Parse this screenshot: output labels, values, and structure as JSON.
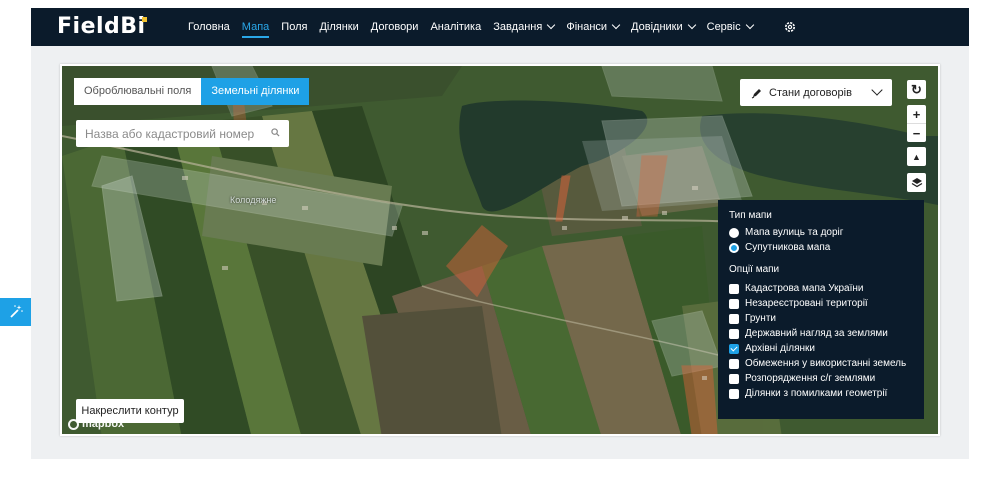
{
  "brand": {
    "logo_text": "FieldBi",
    "logo_main": "Field",
    "logo_accent": "Bi"
  },
  "nav": {
    "items": [
      {
        "label": "Головна",
        "active": false,
        "dropdown": false
      },
      {
        "label": "Мапа",
        "active": true,
        "dropdown": false
      },
      {
        "label": "Поля",
        "active": false,
        "dropdown": false
      },
      {
        "label": "Ділянки",
        "active": false,
        "dropdown": false
      },
      {
        "label": "Договори",
        "active": false,
        "dropdown": false
      },
      {
        "label": "Аналітика",
        "active": false,
        "dropdown": false
      },
      {
        "label": "Завдання",
        "active": false,
        "dropdown": true
      },
      {
        "label": "Фінанси",
        "active": false,
        "dropdown": true
      },
      {
        "label": "Довідники",
        "active": false,
        "dropdown": true
      },
      {
        "label": "Сервіс",
        "active": false,
        "dropdown": true
      }
    ],
    "settings_icon": "gear-icon"
  },
  "map": {
    "tabs": [
      {
        "label": "Оброблювальні поля",
        "active": false
      },
      {
        "label": "Земельні ділянки",
        "active": true
      }
    ],
    "search": {
      "placeholder": "Назва або кадастровий номер",
      "value": ""
    },
    "contracts_dropdown": {
      "label": "Стани договорів",
      "icon": "pen-icon"
    },
    "controls": {
      "refresh": "↻",
      "zoom_in": "+",
      "zoom_out": "−",
      "compass": "▲",
      "layers_icon": "layers-icon"
    },
    "village_label": "Колодяжне",
    "draw_button": "Накреслити контур",
    "attribution": "mapbox"
  },
  "layers_panel": {
    "map_type_title": "Тип мапи",
    "map_types": [
      {
        "label": "Мапа вулиць та доріг",
        "selected": false
      },
      {
        "label": "Супутникова мапа",
        "selected": true
      }
    ],
    "options_title": "Опції мапи",
    "options": [
      {
        "label": "Кадастрова мапа України",
        "checked": false
      },
      {
        "label": "Незареєстровані території",
        "checked": false
      },
      {
        "label": "Грунти",
        "checked": false
      },
      {
        "label": "Державний нагляд за землями",
        "checked": false
      },
      {
        "label": "Архівні ділянки",
        "checked": true
      },
      {
        "label": "Обмеження у використанні земель",
        "checked": false
      },
      {
        "label": "Розпорядження с/г землями",
        "checked": false
      },
      {
        "label": "Ділянки з помилками геометрії",
        "checked": false
      }
    ]
  },
  "colors": {
    "navbar": "#0b1b2b",
    "accent": "#1ea1e6",
    "archive_parcel": "#e0623a"
  }
}
